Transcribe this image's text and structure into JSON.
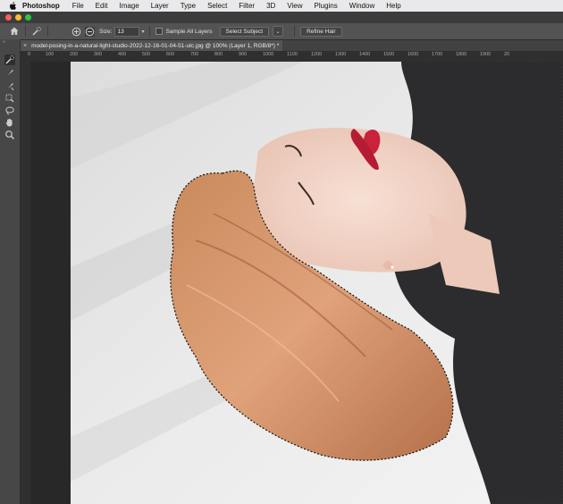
{
  "menubar": {
    "app_name": "Photoshop",
    "items": [
      "File",
      "Edit",
      "Image",
      "Layer",
      "Type",
      "Select",
      "Filter",
      "3D",
      "View",
      "Plugins",
      "Window",
      "Help"
    ]
  },
  "options_bar": {
    "size_label": "Size:",
    "size_value": "13",
    "sample_all_layers": "Sample All Layers",
    "select_subject": "Select Subject",
    "refine_hair": "Refine Hair"
  },
  "document": {
    "tab_title": "model-posing-in-a-natural-light-studio-2022-12-16-01-04-51-utc.jpg @ 100% (Layer 1, RGB/8*) *"
  },
  "ruler": {
    "ticks": [
      "0",
      "100",
      "200",
      "300",
      "400",
      "500",
      "600",
      "700",
      "800",
      "900",
      "1000",
      "1100",
      "1200",
      "1300",
      "1400",
      "1500",
      "1600",
      "1700",
      "1800",
      "1900",
      "20"
    ]
  },
  "colors": {
    "menubar": "#e9e9eb",
    "panel": "#535353",
    "canvas": "#282828"
  }
}
